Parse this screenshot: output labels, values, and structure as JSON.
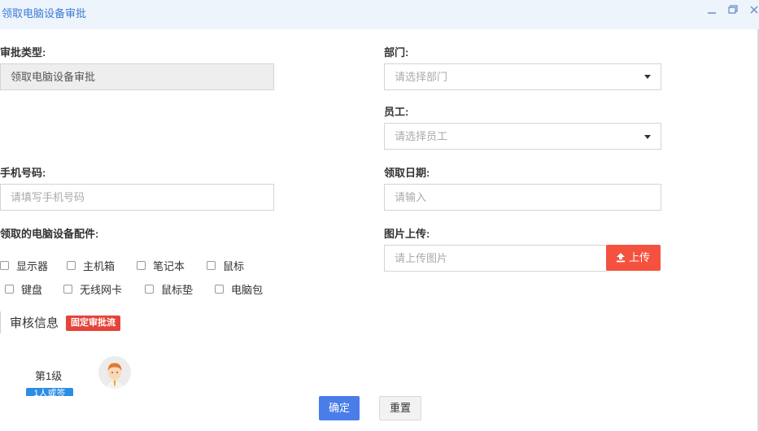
{
  "window": {
    "title": "领取电脑设备审批",
    "minimize_icon": "minimize-icon",
    "restore_icon": "restore-icon",
    "close_icon": "close-icon"
  },
  "form": {
    "approval_type": {
      "label": "审批类型:",
      "value": "领取电脑设备审批"
    },
    "department": {
      "label": "部门:",
      "placeholder": "请选择部门"
    },
    "employee": {
      "label": "员工:",
      "placeholder": "请选择员工"
    },
    "phone": {
      "label": "手机号码:",
      "placeholder": "请填写手机号码"
    },
    "receive_date": {
      "label": "领取日期:",
      "placeholder": "请输入"
    },
    "image_upload": {
      "label": "图片上传:",
      "placeholder": "请上传图片",
      "button_label": "上传",
      "button_icon": "upload-icon"
    },
    "accessories": {
      "label": "领取的电脑设备配件:",
      "options": [
        "显示器",
        "主机箱",
        "笔记本",
        "鼠标",
        "键盘",
        "无线网卡",
        "鼠标垫",
        "电脑包"
      ]
    }
  },
  "review": {
    "title": "审核信息",
    "badge": "固定审批流",
    "level_label": "第1级",
    "level_tag": "1人或签"
  },
  "footer": {
    "confirm_label": "确定",
    "reset_label": "重置"
  },
  "colors": {
    "accent": "#4a7de8",
    "danger": "#f5513f",
    "title_text": "#3a7bd5"
  }
}
